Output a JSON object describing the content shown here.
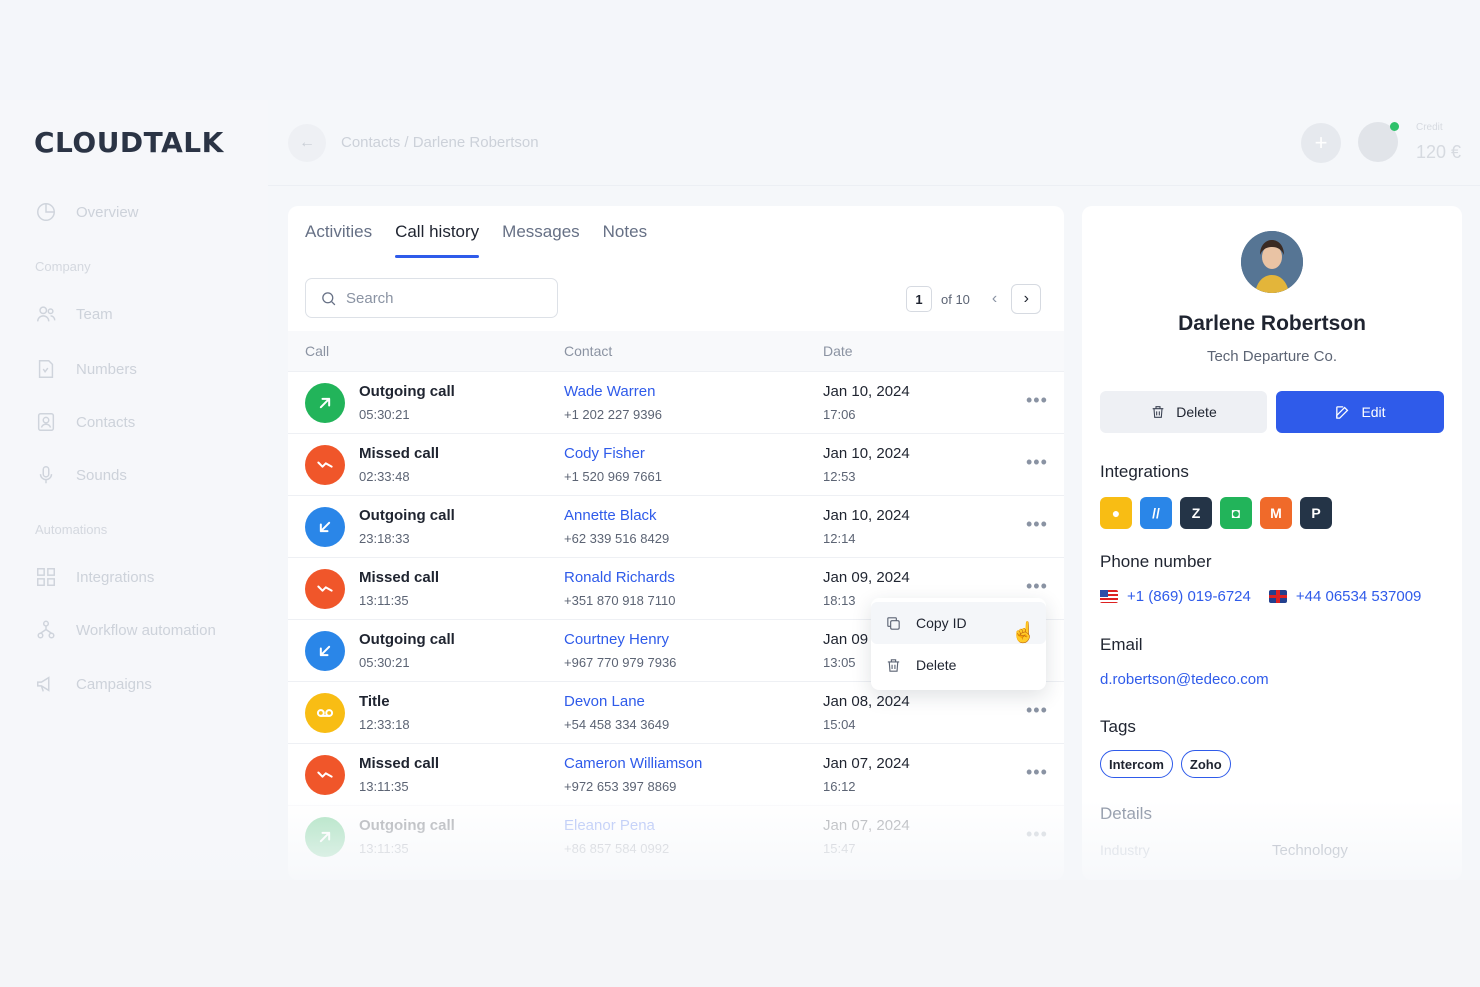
{
  "app": {
    "logo_text": "CLOUDTALK"
  },
  "sidebar": {
    "overview": "Overview",
    "section_company": "Company",
    "team": "Team",
    "numbers": "Numbers",
    "contacts": "Contacts",
    "sounds": "Sounds",
    "section_automations": "Automations",
    "integrations": "Integrations",
    "workflow": "Workflow automation",
    "campaigns": "Campaigns"
  },
  "topbar": {
    "breadcrumb": "Contacts / Darlene Robertson",
    "credit_label": "Credit",
    "credit_value": "120 €"
  },
  "tabs": [
    "Activities",
    "Call history",
    "Messages",
    "Notes"
  ],
  "active_tab": "Call history",
  "search": {
    "placeholder": "Search"
  },
  "pager": {
    "current": "1",
    "of": "of 10"
  },
  "table": {
    "headers": {
      "call": "Call",
      "contact": "Contact",
      "date": "Date"
    },
    "rows": [
      {
        "type": "Outgoing call",
        "duration": "05:30:21",
        "name": "Wade Warren",
        "phone": "+1 202 227 9396",
        "date": "Jan 10, 2024",
        "time": "17:06",
        "icon": "outgoing-arrow-icon",
        "color": "#22b45a"
      },
      {
        "type": "Missed call",
        "duration": "02:33:48",
        "name": "Cody Fisher",
        "phone": "+1 520 969 7661",
        "date": "Jan 10, 2024",
        "time": "12:53",
        "icon": "missed-call-icon",
        "color": "#f0562a"
      },
      {
        "type": "Outgoing call",
        "duration": "23:18:33",
        "name": "Annette Black",
        "phone": "+62 339 516 8429",
        "date": "Jan 10, 2024",
        "time": "12:14",
        "icon": "incoming-arrow-icon",
        "color": "#2a86e8"
      },
      {
        "type": "Missed call",
        "duration": "13:11:35",
        "name": "Ronald Richards",
        "phone": "+351 870 918 7110",
        "date": "Jan 09, 2024",
        "time": "18:13",
        "icon": "missed-call-icon",
        "color": "#f0562a"
      },
      {
        "type": "Outgoing call",
        "duration": "05:30:21",
        "name": "Courtney Henry",
        "phone": "+967 770 979 7936",
        "date": "Jan 09",
        "time": "13:05",
        "icon": "incoming-arrow-icon",
        "color": "#2a86e8"
      },
      {
        "type": "Title",
        "duration": "12:33:18",
        "name": "Devon Lane",
        "phone": "+54 458 334 3649",
        "date": "Jan 08, 2024",
        "time": "15:04",
        "icon": "voicemail-icon",
        "color": "#f8bd14"
      },
      {
        "type": "Missed call",
        "duration": "13:11:35",
        "name": "Cameron Williamson",
        "phone": "+972 653 397 8869",
        "date": "Jan 07, 2024",
        "time": "16:12",
        "icon": "missed-call-icon",
        "color": "#f0562a"
      },
      {
        "type": "Outgoing call",
        "duration": "13:11:35",
        "name": "Eleanor Pena",
        "phone": "+86 857 584 0992",
        "date": "Jan 07, 2024",
        "time": "15:47",
        "icon": "outgoing-arrow-icon",
        "color": "#22b45a"
      }
    ]
  },
  "context_menu": {
    "copy_id": "Copy ID",
    "delete": "Delete"
  },
  "profile": {
    "name": "Darlene Robertson",
    "company": "Tech Departure Co.",
    "delete_label": "Delete",
    "edit_label": "Edit",
    "integrations_title": "Integrations",
    "integrations": [
      {
        "icon": "chat-app-icon",
        "color": "#f8bd14"
      },
      {
        "icon": "slash-app-icon",
        "color": "#2a86e8"
      },
      {
        "icon": "zendesk-icon",
        "color": "#243447"
      },
      {
        "icon": "freshdesk-icon",
        "color": "#22b45a"
      },
      {
        "icon": "magento-icon",
        "color": "#f06a2a"
      },
      {
        "icon": "pipedrive-icon",
        "color": "#243447"
      }
    ],
    "phone_title": "Phone number",
    "phone_us": "+1 (869) 019-6724",
    "phone_uk": "+44 06534 537009",
    "email_title": "Email",
    "email": "d.robertson@tedeco.com",
    "tags_title": "Tags",
    "tags": [
      "Intercom",
      "Zoho"
    ],
    "details_title": "Details",
    "detail_label": "Industry",
    "detail_value": "Technology"
  },
  "colors": {
    "accent": "#2f5bea"
  }
}
